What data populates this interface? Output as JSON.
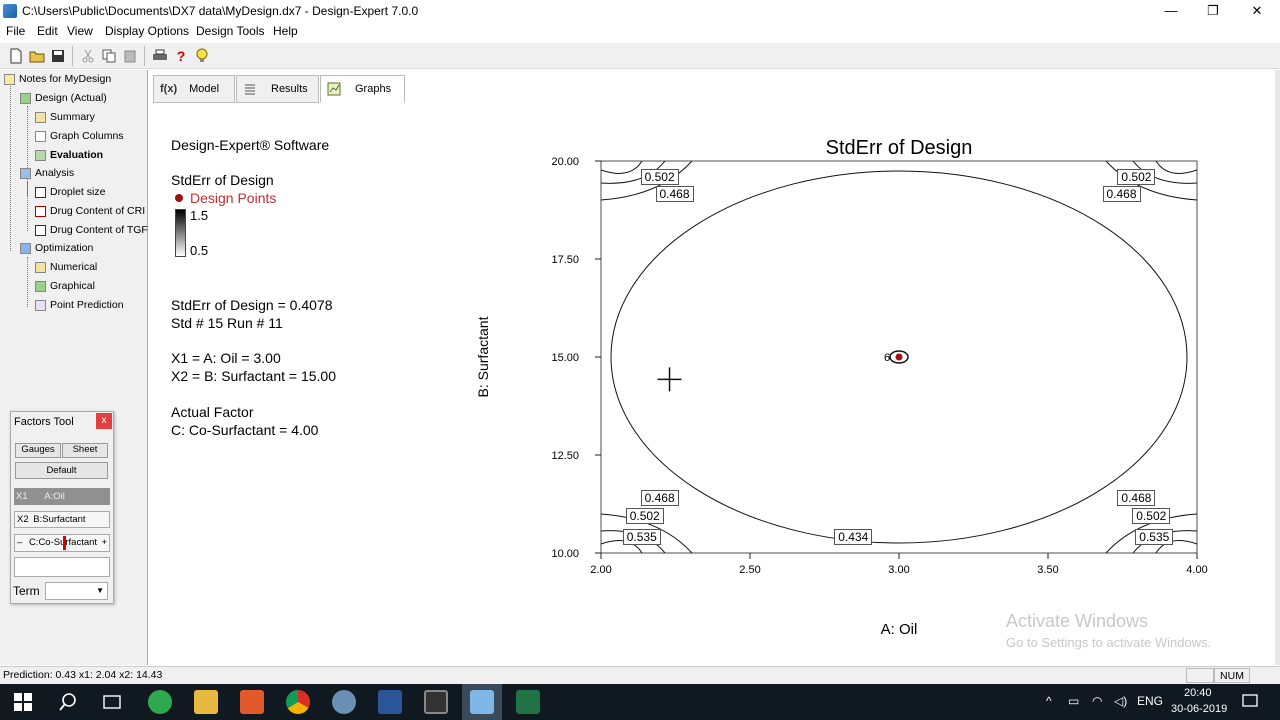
{
  "window": {
    "title": "C:\\Users\\Public\\Documents\\DX7 data\\MyDesign.dx7 - Design-Expert 7.0.0",
    "minimize": "—",
    "maximize": "❐",
    "close": "✕"
  },
  "menu": [
    "File",
    "Edit",
    "View",
    "Display Options",
    "Design Tools",
    "Help"
  ],
  "tree": {
    "root": "Notes for MyDesign",
    "design": "Design (Actual)",
    "summary": "Summary",
    "graph_columns": "Graph Columns",
    "evaluation": "Evaluation",
    "analysis": "Analysis",
    "droplet": "Droplet size",
    "drug_crm": "Drug Content of CRI",
    "drug_tgf": "Drug Content of TGF",
    "optimization": "Optimization",
    "numerical": "Numerical",
    "graphical": "Graphical",
    "point_prediction": "Point Prediction"
  },
  "factors_tool": {
    "title": "Factors Tool",
    "close": "x",
    "gauges": "Gauges",
    "sheet": "Sheet",
    "default": "Default",
    "x1_tag": "X1",
    "x1_name": "A:Oil",
    "x2_tag": "X2",
    "x2_name": "B:Surfactant",
    "c_name": "C:Co-Surfactant",
    "minus": "–",
    "plus": "+",
    "term_label": "Term"
  },
  "tabs": [
    {
      "icon": "f(x)",
      "label": "Model"
    },
    {
      "icon": "",
      "label": "Results"
    },
    {
      "icon": "",
      "label": "Graphs"
    }
  ],
  "info": {
    "software": "Design-Expert® Software",
    "response": "StdErr of Design",
    "design_points": "Design Points",
    "legend_hi": "1.5",
    "legend_lo": "0.5",
    "value_line": "StdErr of Design = 0.4078",
    "std_run": "Std # 15 Run # 11",
    "x1": "X1 = A: Oil = 3.00",
    "x2": "X2 = B: Surfactant = 15.00",
    "actual_factor": "Actual Factor",
    "c_value": "C: Co-Surfactant = 4.00"
  },
  "chart_data": {
    "type": "contour",
    "title": "StdErr of Design",
    "xlabel": "A: Oil",
    "ylabel": "B: Surfactant",
    "xlim": [
      2.0,
      4.0
    ],
    "ylim": [
      10.0,
      20.0
    ],
    "xticks": [
      "2.00",
      "2.50",
      "3.00",
      "3.50",
      "4.00"
    ],
    "yticks": [
      "10.00",
      "12.50",
      "15.00",
      "17.50",
      "20.00"
    ],
    "contour_labels": [
      {
        "text": "0.502",
        "x": 2.2,
        "y": 19.6
      },
      {
        "text": "0.468",
        "x": 2.25,
        "y": 19.15
      },
      {
        "text": "0.502",
        "x": 3.8,
        "y": 19.6
      },
      {
        "text": "0.468",
        "x": 3.75,
        "y": 19.15
      },
      {
        "text": "0.468",
        "x": 2.2,
        "y": 11.4
      },
      {
        "text": "0.502",
        "x": 2.15,
        "y": 10.95
      },
      {
        "text": "0.535",
        "x": 2.14,
        "y": 10.4
      },
      {
        "text": "0.434",
        "x": 2.85,
        "y": 10.4
      },
      {
        "text": "0.468",
        "x": 3.8,
        "y": 11.4
      },
      {
        "text": "0.502",
        "x": 3.85,
        "y": 10.95
      },
      {
        "text": "0.535",
        "x": 3.86,
        "y": 10.4
      }
    ],
    "design_point": {
      "x": 3.0,
      "y": 15.0,
      "label": "6"
    },
    "cursor": {
      "x": 2.23,
      "y": 14.43
    }
  },
  "watermark": {
    "line1": "Activate Windows",
    "line2": "Go to Settings to activate Windows."
  },
  "status": {
    "prediction": "Prediction: 0.43  x1: 2.04  x2: 14.43",
    "num": "NUM"
  },
  "taskbar": {
    "lang": "ENG",
    "time": "20:40",
    "date": "30-06-2019"
  }
}
